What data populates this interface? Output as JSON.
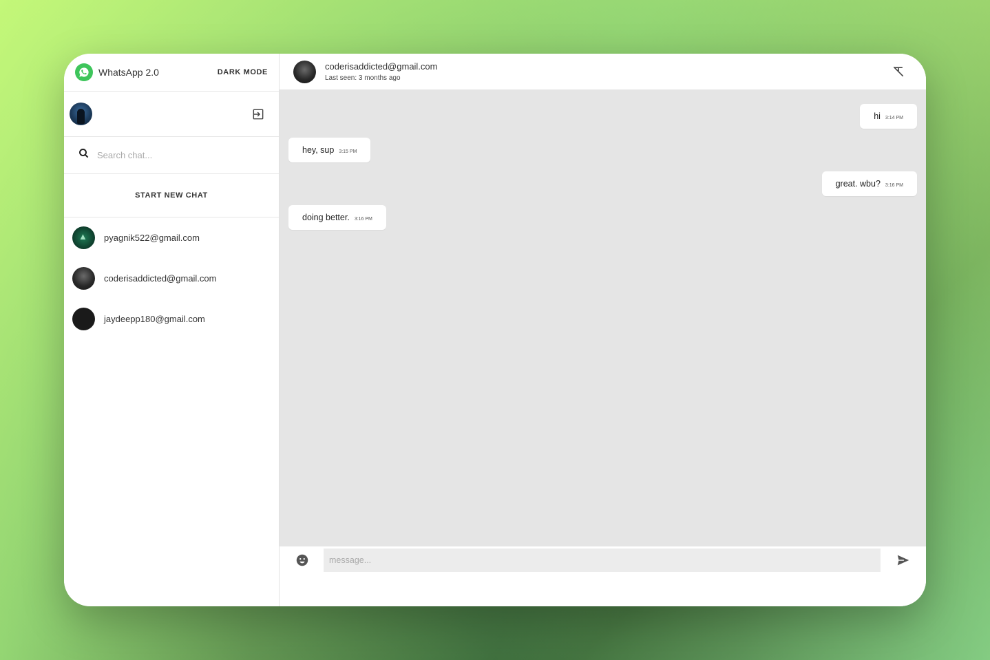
{
  "app": {
    "name": "WhatsApp 2.0",
    "dark_mode_label": "DARK MODE"
  },
  "search": {
    "placeholder": "Search chat..."
  },
  "new_chat_label": "START NEW CHAT",
  "contacts": [
    {
      "email": "pyagnik522@gmail.com"
    },
    {
      "email": "coderisaddicted@gmail.com"
    },
    {
      "email": "jaydeepp180@gmail.com"
    }
  ],
  "chat": {
    "email": "coderisaddicted@gmail.com",
    "last_seen": "Last seen: 3 months ago"
  },
  "messages": [
    {
      "text": "hi",
      "time": "3:14 PM",
      "direction": "sent"
    },
    {
      "text": "hey, sup",
      "time": "3:15 PM",
      "direction": "received"
    },
    {
      "text": "great. wbu?",
      "time": "3:16 PM",
      "direction": "sent"
    },
    {
      "text": "doing better.",
      "time": "3:16 PM",
      "direction": "received"
    }
  ],
  "composer": {
    "placeholder": "message..."
  },
  "icons": {
    "brand": "whatsapp-logo-icon",
    "logout": "logout-icon",
    "search": "search-icon",
    "clear": "clear-formatting-icon",
    "emoji": "emoji-icon",
    "send": "send-icon"
  },
  "colors": {
    "brand_green": "#3ec55b",
    "chat_bg": "#e5e5e5"
  }
}
